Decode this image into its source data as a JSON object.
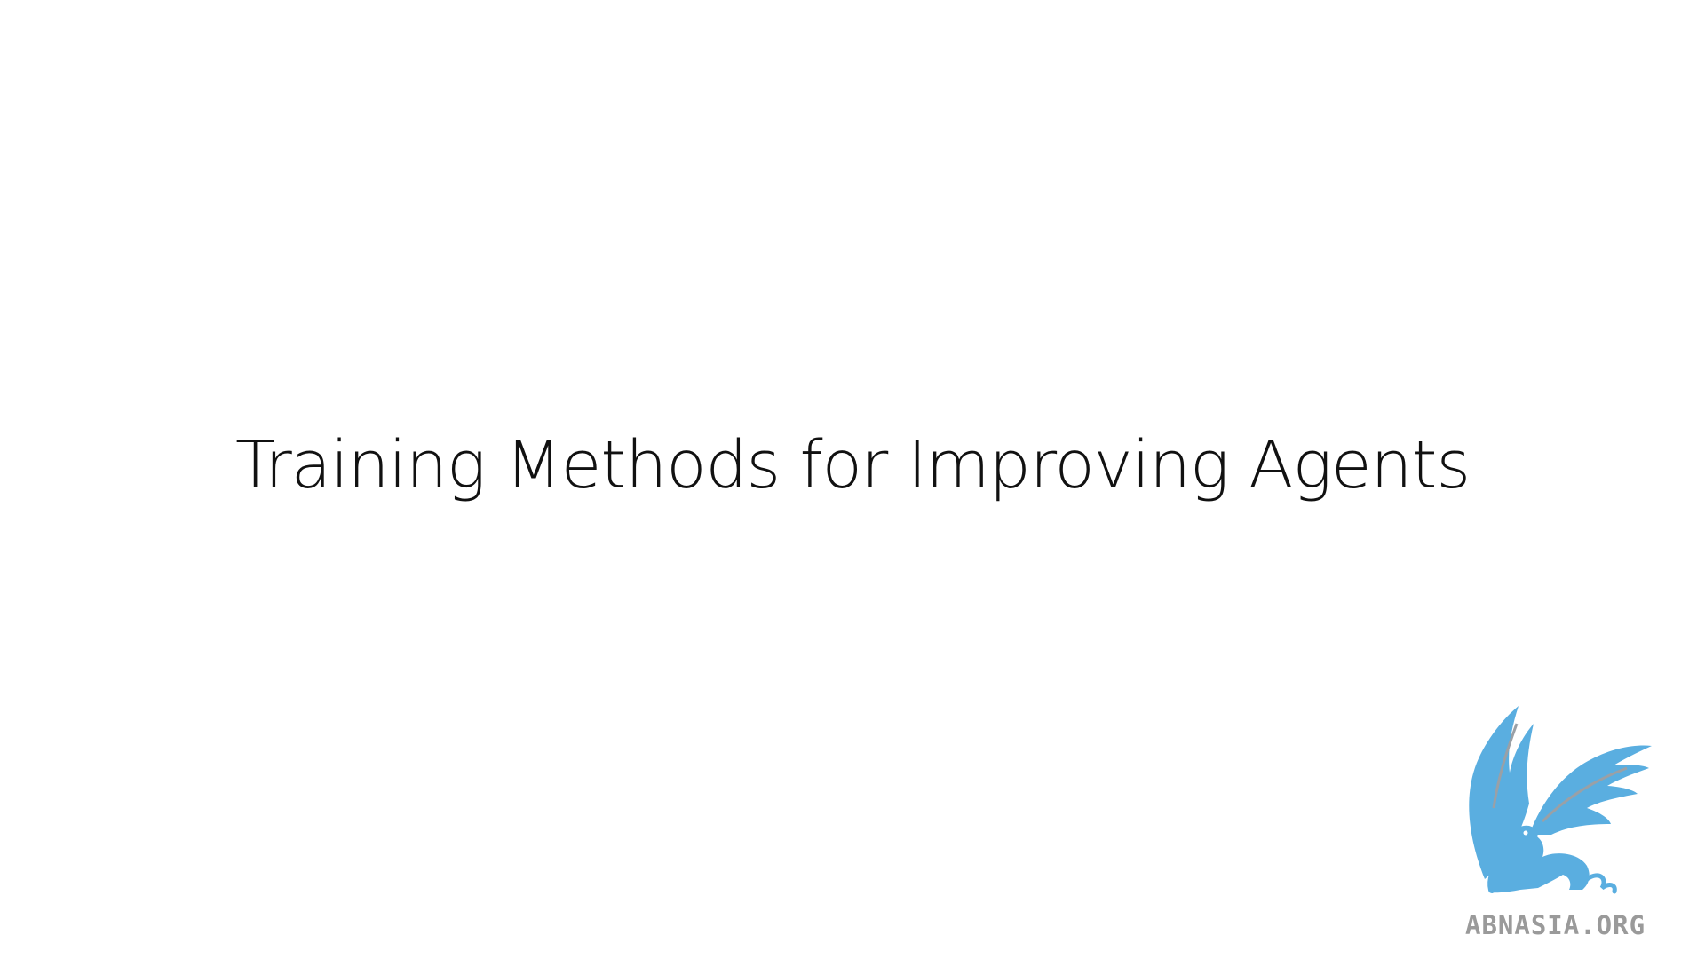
{
  "slide": {
    "title": "Training Methods for Improving Agents"
  },
  "logo": {
    "icon": "griffin-logo-icon",
    "text": "ABNASIA.ORG",
    "color_primary": "#5aaee0",
    "color_accent": "#9aa0a6",
    "text_color": "#9a9a9a"
  }
}
